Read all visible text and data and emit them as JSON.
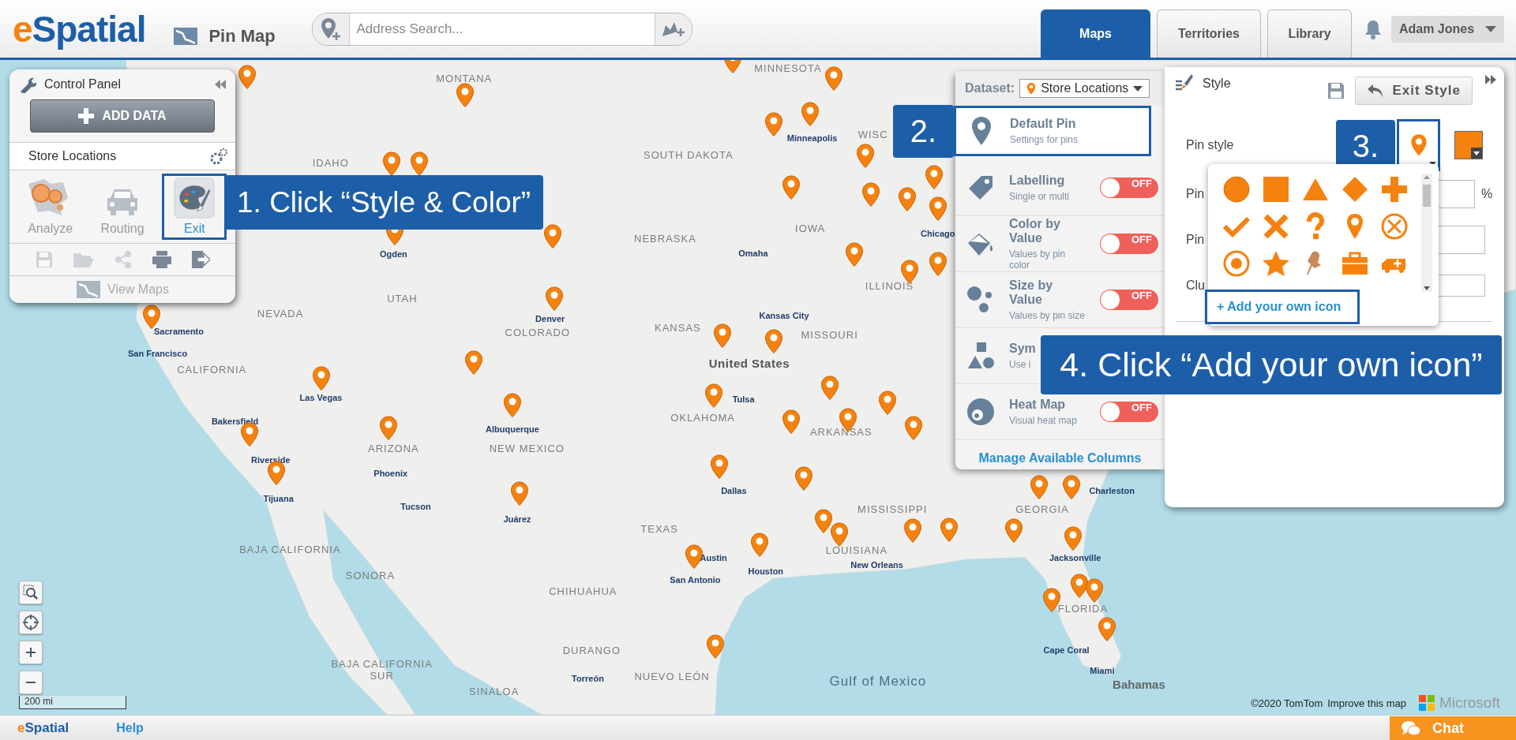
{
  "header": {
    "logo": "eSpatial",
    "page_title": "Pin Map",
    "search": {
      "placeholder": "Address Search..."
    },
    "tabs": [
      {
        "label": "Maps",
        "selected": true
      },
      {
        "label": "Territories",
        "selected": false
      },
      {
        "label": "Library",
        "selected": false
      }
    ],
    "user": "Adam Jones"
  },
  "control_panel": {
    "title": "Control Panel",
    "add_button": "ADD DATA",
    "dataset": "Store Locations",
    "tools": [
      {
        "label": "Analyze",
        "kind": "analyze",
        "selected": false
      },
      {
        "label": "Routing",
        "kind": "routing",
        "selected": false
      },
      {
        "label": "Exit",
        "kind": "style",
        "selected": true
      }
    ],
    "actions": [
      {
        "kind": "save",
        "disabled": true
      },
      {
        "kind": "open",
        "disabled": true
      },
      {
        "kind": "share",
        "disabled": true
      },
      {
        "kind": "print",
        "disabled": false
      },
      {
        "kind": "export",
        "disabled": false
      }
    ],
    "view_maps": "View Maps"
  },
  "dataset_panel": {
    "label": "Dataset:",
    "dataset": "Store Locations",
    "items": [
      {
        "kind": "pin",
        "title": "Default Pin",
        "subtitle": "Settings for pins",
        "selected": true
      },
      {
        "kind": "label",
        "title": "Labelling",
        "subtitle": "Single or multi",
        "selected": false,
        "toggle": {
          "on": false,
          "label": "OFF"
        }
      },
      {
        "kind": "color",
        "title": "Color by Value",
        "subtitle": "Values by pin color",
        "selected": false,
        "toggle": {
          "on": false,
          "label": "OFF"
        }
      },
      {
        "kind": "size",
        "title": "Size by Value",
        "subtitle": "Values by pin size",
        "selected": false,
        "toggle": {
          "on": false,
          "label": "OFF"
        }
      },
      {
        "kind": "symbol",
        "title": "Sym",
        "subtitle": "Use i",
        "selected": false
      },
      {
        "kind": "heat",
        "title": "Heat Map",
        "subtitle": "Visual heat map",
        "selected": false,
        "toggle": {
          "on": false,
          "label": "OFF"
        }
      }
    ],
    "link": "Manage Available Columns"
  },
  "style_panel": {
    "title": "Style",
    "exit_button": "Exit Style",
    "rows": [
      {
        "label": "Pin style",
        "kind": "pin"
      },
      {
        "label": "Pin",
        "kind": "percent",
        "unit": "%"
      },
      {
        "label": "Pin",
        "kind": "input"
      },
      {
        "label": "Clu",
        "kind": "select"
      }
    ],
    "pin_menu": {
      "icons": [
        {
          "kind": "circle"
        },
        {
          "kind": "square"
        },
        {
          "kind": "triangle"
        },
        {
          "kind": "diamond"
        },
        {
          "kind": "plus"
        },
        {
          "kind": "check"
        },
        {
          "kind": "cross"
        },
        {
          "kind": "question"
        },
        {
          "kind": "pin"
        },
        {
          "kind": "circle-x"
        },
        {
          "kind": "target"
        },
        {
          "kind": "star"
        },
        {
          "kind": "pushpin"
        },
        {
          "kind": "briefcase"
        },
        {
          "kind": "ambulance"
        }
      ],
      "link": "+ Add your own icon"
    }
  },
  "callouts": [
    {
      "text": "1. Click “Style & Color”"
    },
    {
      "text": "2."
    },
    {
      "text": "3."
    },
    {
      "text": "4. Click “Add your own icon”"
    }
  ],
  "map": {
    "labels": [
      {
        "text": "MINNESOTA",
        "kind": "region"
      },
      {
        "text": "MONTANA",
        "kind": "region"
      },
      {
        "text": "IDAHO",
        "kind": "region"
      },
      {
        "text": "SOUTH DAKOTA",
        "kind": "region"
      },
      {
        "text": "Minneapolis",
        "kind": "city"
      },
      {
        "text": "WISC",
        "kind": "region"
      },
      {
        "text": "NEBRASKA",
        "kind": "region"
      },
      {
        "text": "IOWA",
        "kind": "region"
      },
      {
        "text": "Omaha",
        "kind": "city"
      },
      {
        "text": "Chicago",
        "kind": "city"
      },
      {
        "text": "ILLINOIS",
        "kind": "region"
      },
      {
        "text": "Ogden",
        "kind": "city"
      },
      {
        "text": "NEVADA",
        "kind": "region"
      },
      {
        "text": "UTAH",
        "kind": "region"
      },
      {
        "text": "Denver",
        "kind": "city"
      },
      {
        "text": "COLORADO",
        "kind": "region"
      },
      {
        "text": "KANSAS",
        "kind": "region"
      },
      {
        "text": "Kansas City",
        "kind": "city"
      },
      {
        "text": "MISSOURI",
        "kind": "region"
      },
      {
        "text": "Sacramento",
        "kind": "city"
      },
      {
        "text": "San Francisco",
        "kind": "city"
      },
      {
        "text": "CALIFORNIA",
        "kind": "region"
      },
      {
        "text": "United States",
        "kind": "country"
      },
      {
        "text": "Las Vegas",
        "kind": "city"
      },
      {
        "text": "Tulsa",
        "kind": "city"
      },
      {
        "text": "OKLAHOMA",
        "kind": "region"
      },
      {
        "text": "ARKANSAS",
        "kind": "region"
      },
      {
        "text": "Bakersfield",
        "kind": "city"
      },
      {
        "text": "Albuquerque",
        "kind": "city"
      },
      {
        "text": "ARIZONA",
        "kind": "region"
      },
      {
        "text": "NEW MEXICO",
        "kind": "region"
      },
      {
        "text": "Riverside",
        "kind": "city"
      },
      {
        "text": "Phoenix",
        "kind": "city"
      },
      {
        "text": "Dallas",
        "kind": "city"
      },
      {
        "text": "Charleston",
        "kind": "city"
      },
      {
        "text": "Tijuana",
        "kind": "city"
      },
      {
        "text": "Tucson",
        "kind": "city"
      },
      {
        "text": "MISSISSIPPI",
        "kind": "region"
      },
      {
        "text": "GEORGIA",
        "kind": "region"
      },
      {
        "text": "Juárez",
        "kind": "city"
      },
      {
        "text": "TEXAS",
        "kind": "region"
      },
      {
        "text": "BAJA CALIFORNIA",
        "kind": "region"
      },
      {
        "text": "LOUISIANA",
        "kind": "region"
      },
      {
        "text": "Austin",
        "kind": "city"
      },
      {
        "text": "New Orleans",
        "kind": "city"
      },
      {
        "text": "Houston",
        "kind": "city"
      },
      {
        "text": "Jacksonville",
        "kind": "city"
      },
      {
        "text": "SONORA",
        "kind": "region"
      },
      {
        "text": "San Antonio",
        "kind": "city"
      },
      {
        "text": "CHIHUAHUA",
        "kind": "region"
      },
      {
        "text": "FLORIDA",
        "kind": "region"
      },
      {
        "text": "DURANGO",
        "kind": "region"
      },
      {
        "text": "Cape Coral",
        "kind": "city"
      },
      {
        "text": "BAJA CALIFORNIA SUR",
        "kind": "region"
      },
      {
        "text": "Torreón",
        "kind": "city"
      },
      {
        "text": "NUEVO LEÓN",
        "kind": "region"
      },
      {
        "text": "SINALOA",
        "kind": "region"
      },
      {
        "text": "Miami",
        "kind": "city"
      },
      {
        "text": "Gulf of Mexico",
        "kind": "water"
      },
      {
        "text": "Bahamas",
        "kind": "island"
      }
    ],
    "scale": "200 mi",
    "attribution": "©2020 TomTom",
    "improve_link": "Improve this map",
    "provider": "Microsoft"
  },
  "footer": {
    "logo": "eSpatial",
    "help": "Help",
    "chat": "Chat"
  }
}
